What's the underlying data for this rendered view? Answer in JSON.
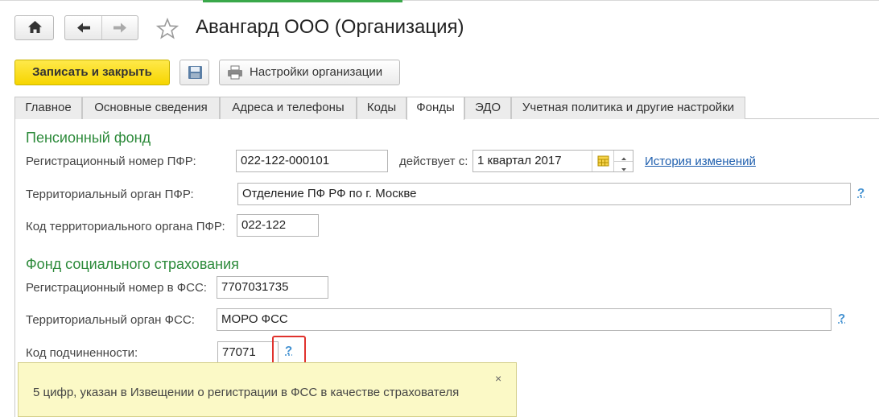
{
  "window": {
    "title": "Авангард ООО (Организация)"
  },
  "toolbar": {
    "save_close_label": "Записать и закрыть",
    "settings_label": "Настройки организации"
  },
  "tabs": [
    {
      "label": "Главное"
    },
    {
      "label": "Основные сведения"
    },
    {
      "label": "Адреса и телефоны"
    },
    {
      "label": "Коды"
    },
    {
      "label": "Фонды",
      "active": true
    },
    {
      "label": "ЭДО"
    },
    {
      "label": "Учетная политика и другие настройки"
    }
  ],
  "pfr": {
    "heading": "Пенсионный фонд",
    "reg_number_label": "Регистрационный номер ПФР:",
    "reg_number_value": "022-122-000101",
    "valid_from_label": "действует с:",
    "valid_from_value": "1 квартал 2017",
    "history_link": "История изменений",
    "territorial_label": "Территориальный орган ПФР:",
    "territorial_value": "Отделение ПФ РФ по г. Москве",
    "code_label": "Код территориального органа ПФР:",
    "code_value": "022-122"
  },
  "fss": {
    "heading": "Фонд социального страхования",
    "reg_number_label": "Регистрационный номер в ФСС:",
    "reg_number_value": "7707031735",
    "territorial_label": "Территориальный орган ФСС:",
    "territorial_value": "МОРО ФСС",
    "subordination_label": "Код подчиненности:",
    "subordination_value": "77071"
  },
  "help_mark": "?",
  "tooltip": {
    "text": "5 цифр, указан в Извещении о регистрации в ФСС в качестве страхователя",
    "close": "×"
  },
  "colors": {
    "accent_yellow": "#f6d500",
    "section_green": "#2c8a3a",
    "link_blue": "#1f5fae",
    "highlight_red": "#e0322d",
    "tooltip_bg": "#fbf9c6"
  },
  "icons": [
    "home-icon",
    "back-arrow-icon",
    "forward-arrow-icon",
    "star-icon",
    "save-disk-icon",
    "printer-icon",
    "calendar-icon",
    "spin-up-icon",
    "spin-down-icon",
    "close-icon"
  ]
}
